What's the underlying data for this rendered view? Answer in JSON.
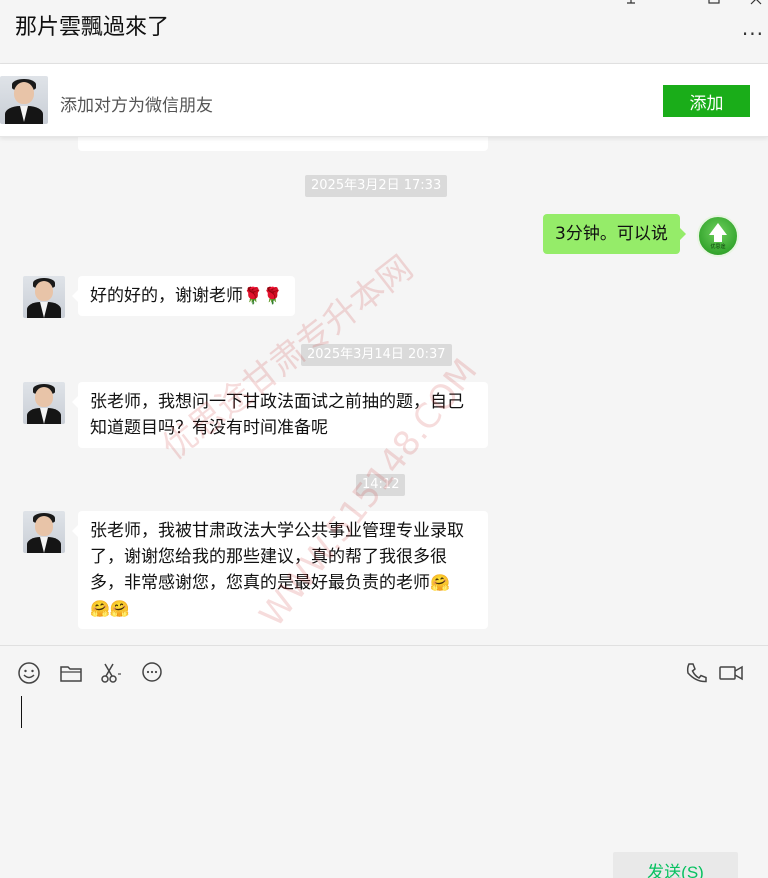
{
  "window": {
    "title": "那片雲飄過來了",
    "more_label": "···"
  },
  "add_bar": {
    "prompt": "添加对方为微信朋友",
    "add_label": "添加"
  },
  "messages": [
    {
      "type": "time",
      "text": "2025年3月2日 17:33"
    },
    {
      "type": "sent",
      "text": "3分钟。可以说",
      "avatar_label": "优思途"
    },
    {
      "type": "received",
      "text": "好的好的，谢谢老师",
      "emoji": "🌹🌹"
    },
    {
      "type": "time",
      "text": "2025年3月14日 20:37"
    },
    {
      "type": "received",
      "lines": [
        "张老师，我想问一下甘政法面试之前抽的题，自己",
        "知道题目吗？有没有时间准备呢"
      ]
    },
    {
      "type": "time",
      "text": "14:12"
    },
    {
      "type": "received",
      "lines": [
        "张老师，我被甘肃政法大学公共事业管理专业录取",
        "了，谢谢您给我的那些建议，真的帮了我很多很",
        "多，非常感谢您，您真的是最好最负责的老师"
      ],
      "emoji_inline": "🤗",
      "emoji_line": "🤗🤗"
    }
  ],
  "watermark": {
    "text": "优思途甘肃专升本网",
    "url": "WWW.515148.COM"
  },
  "composer": {
    "tools": [
      "emoji-icon",
      "folder-icon",
      "scissors-icon",
      "chat-bubble-icon",
      "phone-icon",
      "video-icon"
    ],
    "send_label": "发送(S)"
  },
  "colors": {
    "accent_green": "#1aad19",
    "sent_bubble": "#95ec69",
    "send_text": "#07c160"
  }
}
